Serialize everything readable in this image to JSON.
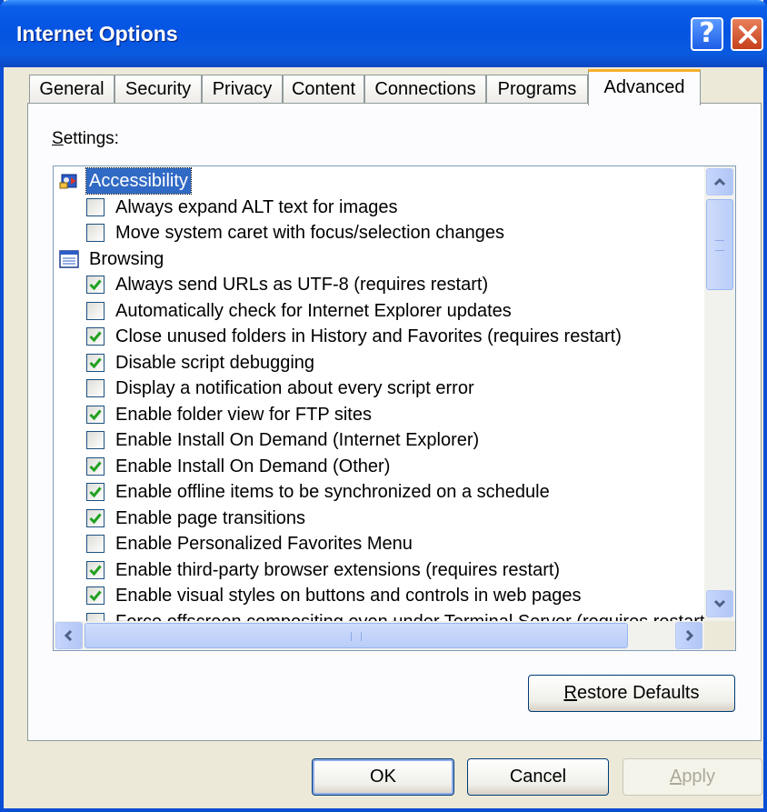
{
  "window": {
    "title": "Internet Options"
  },
  "titlebar": {
    "help_glyph": "?"
  },
  "tabs": [
    {
      "label": "General"
    },
    {
      "label": "Security"
    },
    {
      "label": "Privacy"
    },
    {
      "label": "Content"
    },
    {
      "label": "Connections"
    },
    {
      "label": "Programs"
    },
    {
      "label": "Advanced",
      "active": true
    }
  ],
  "settings": {
    "label_accel": "S",
    "label_rest": "ettings:",
    "categories": [
      {
        "label": "Accessibility",
        "icon": "accessibility-icon",
        "selected": true,
        "items": [
          {
            "label": "Always expand ALT text for images",
            "checked": false
          },
          {
            "label": "Move system caret with focus/selection changes",
            "checked": false
          }
        ]
      },
      {
        "label": "Browsing",
        "icon": "browsing-icon",
        "selected": false,
        "items": [
          {
            "label": "Always send URLs as UTF-8 (requires restart)",
            "checked": true
          },
          {
            "label": "Automatically check for Internet Explorer updates",
            "checked": false
          },
          {
            "label": "Close unused folders in History and Favorites (requires restart)",
            "checked": true
          },
          {
            "label": "Disable script debugging",
            "checked": true
          },
          {
            "label": "Display a notification about every script error",
            "checked": false
          },
          {
            "label": "Enable folder view for FTP sites",
            "checked": true
          },
          {
            "label": "Enable Install On Demand (Internet Explorer)",
            "checked": false
          },
          {
            "label": "Enable Install On Demand (Other)",
            "checked": true
          },
          {
            "label": "Enable offline items to be synchronized on a schedule",
            "checked": true
          },
          {
            "label": "Enable page transitions",
            "checked": true
          },
          {
            "label": "Enable Personalized Favorites Menu",
            "checked": false
          },
          {
            "label": "Enable third-party browser extensions (requires restart)",
            "checked": true
          },
          {
            "label": "Enable visual styles on buttons and controls in web pages",
            "checked": true
          },
          {
            "label": "Force offscreen compositing even under Terminal Server (requires restart)",
            "checked": false
          }
        ]
      }
    ]
  },
  "buttons": {
    "restore_accel": "R",
    "restore_rest": "estore Defaults",
    "ok": "OK",
    "cancel": "Cancel",
    "apply_accel": "A",
    "apply_rest": "pply"
  },
  "colors": {
    "titlebar": "#0554e3",
    "selection": "#316ac5",
    "check": "#21a121",
    "active_tab_accent": "#f9b02c"
  }
}
